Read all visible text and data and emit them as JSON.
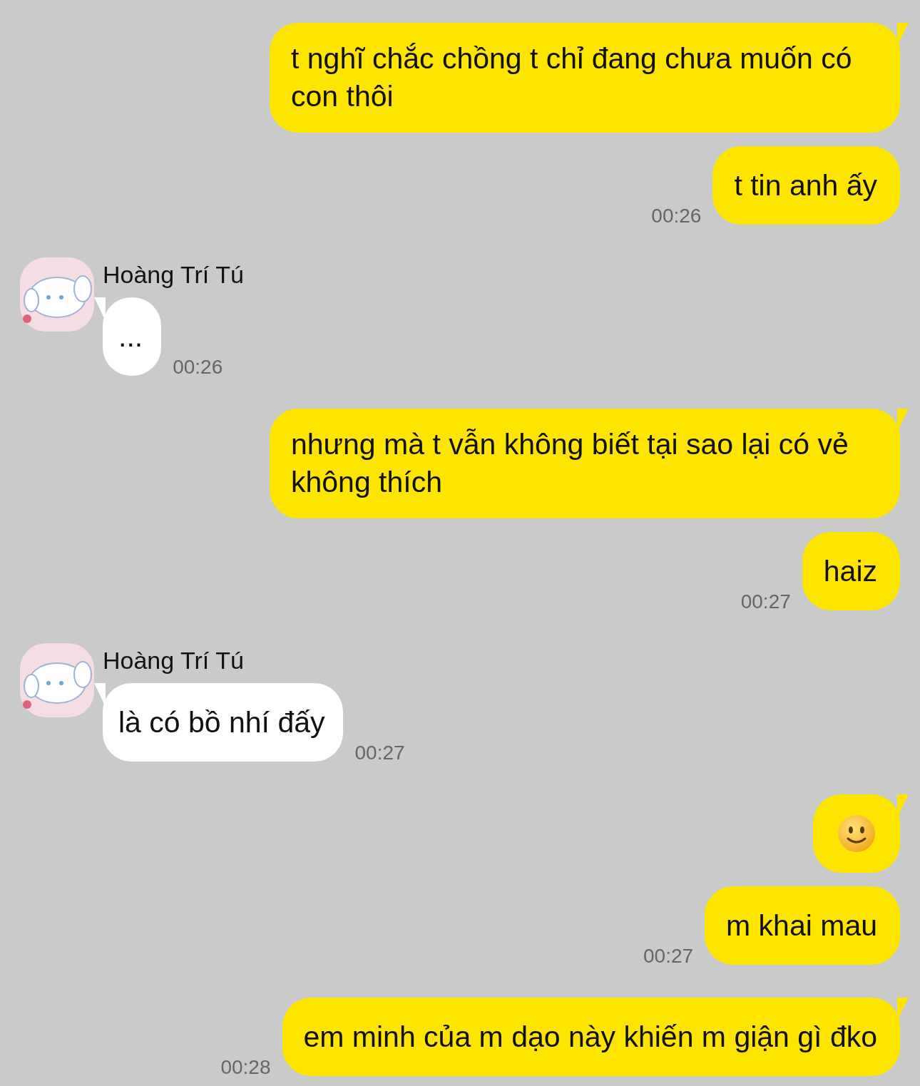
{
  "messages": [
    {
      "kind": "sent",
      "text": "t nghĩ chắc chồng t chỉ đang chưa muốn có con thôi",
      "tail": true
    },
    {
      "kind": "sent",
      "text": "t tin anh ấy",
      "time": "00:26",
      "tail": false
    },
    {
      "kind": "received",
      "sender": "Hoàng Trí Tú",
      "text": "...",
      "time": "00:26",
      "tail": true
    },
    {
      "kind": "sent",
      "text": "nhưng mà t vẫn không biết tại sao lại có vẻ không thích",
      "tail": true
    },
    {
      "kind": "sent",
      "text": "haiz",
      "time": "00:27",
      "tail": false
    },
    {
      "kind": "received",
      "sender": "Hoàng Trí Tú",
      "text": "là có bồ nhí đấy",
      "time": "00:27",
      "tail": true
    },
    {
      "kind": "emoji",
      "tail": true
    },
    {
      "kind": "sent",
      "text": "m khai mau",
      "time": "00:27",
      "tail": false
    },
    {
      "kind": "sent",
      "text": "em minh của m dạo này khiến m giận gì đko",
      "time": "00:28",
      "tail": true
    }
  ]
}
